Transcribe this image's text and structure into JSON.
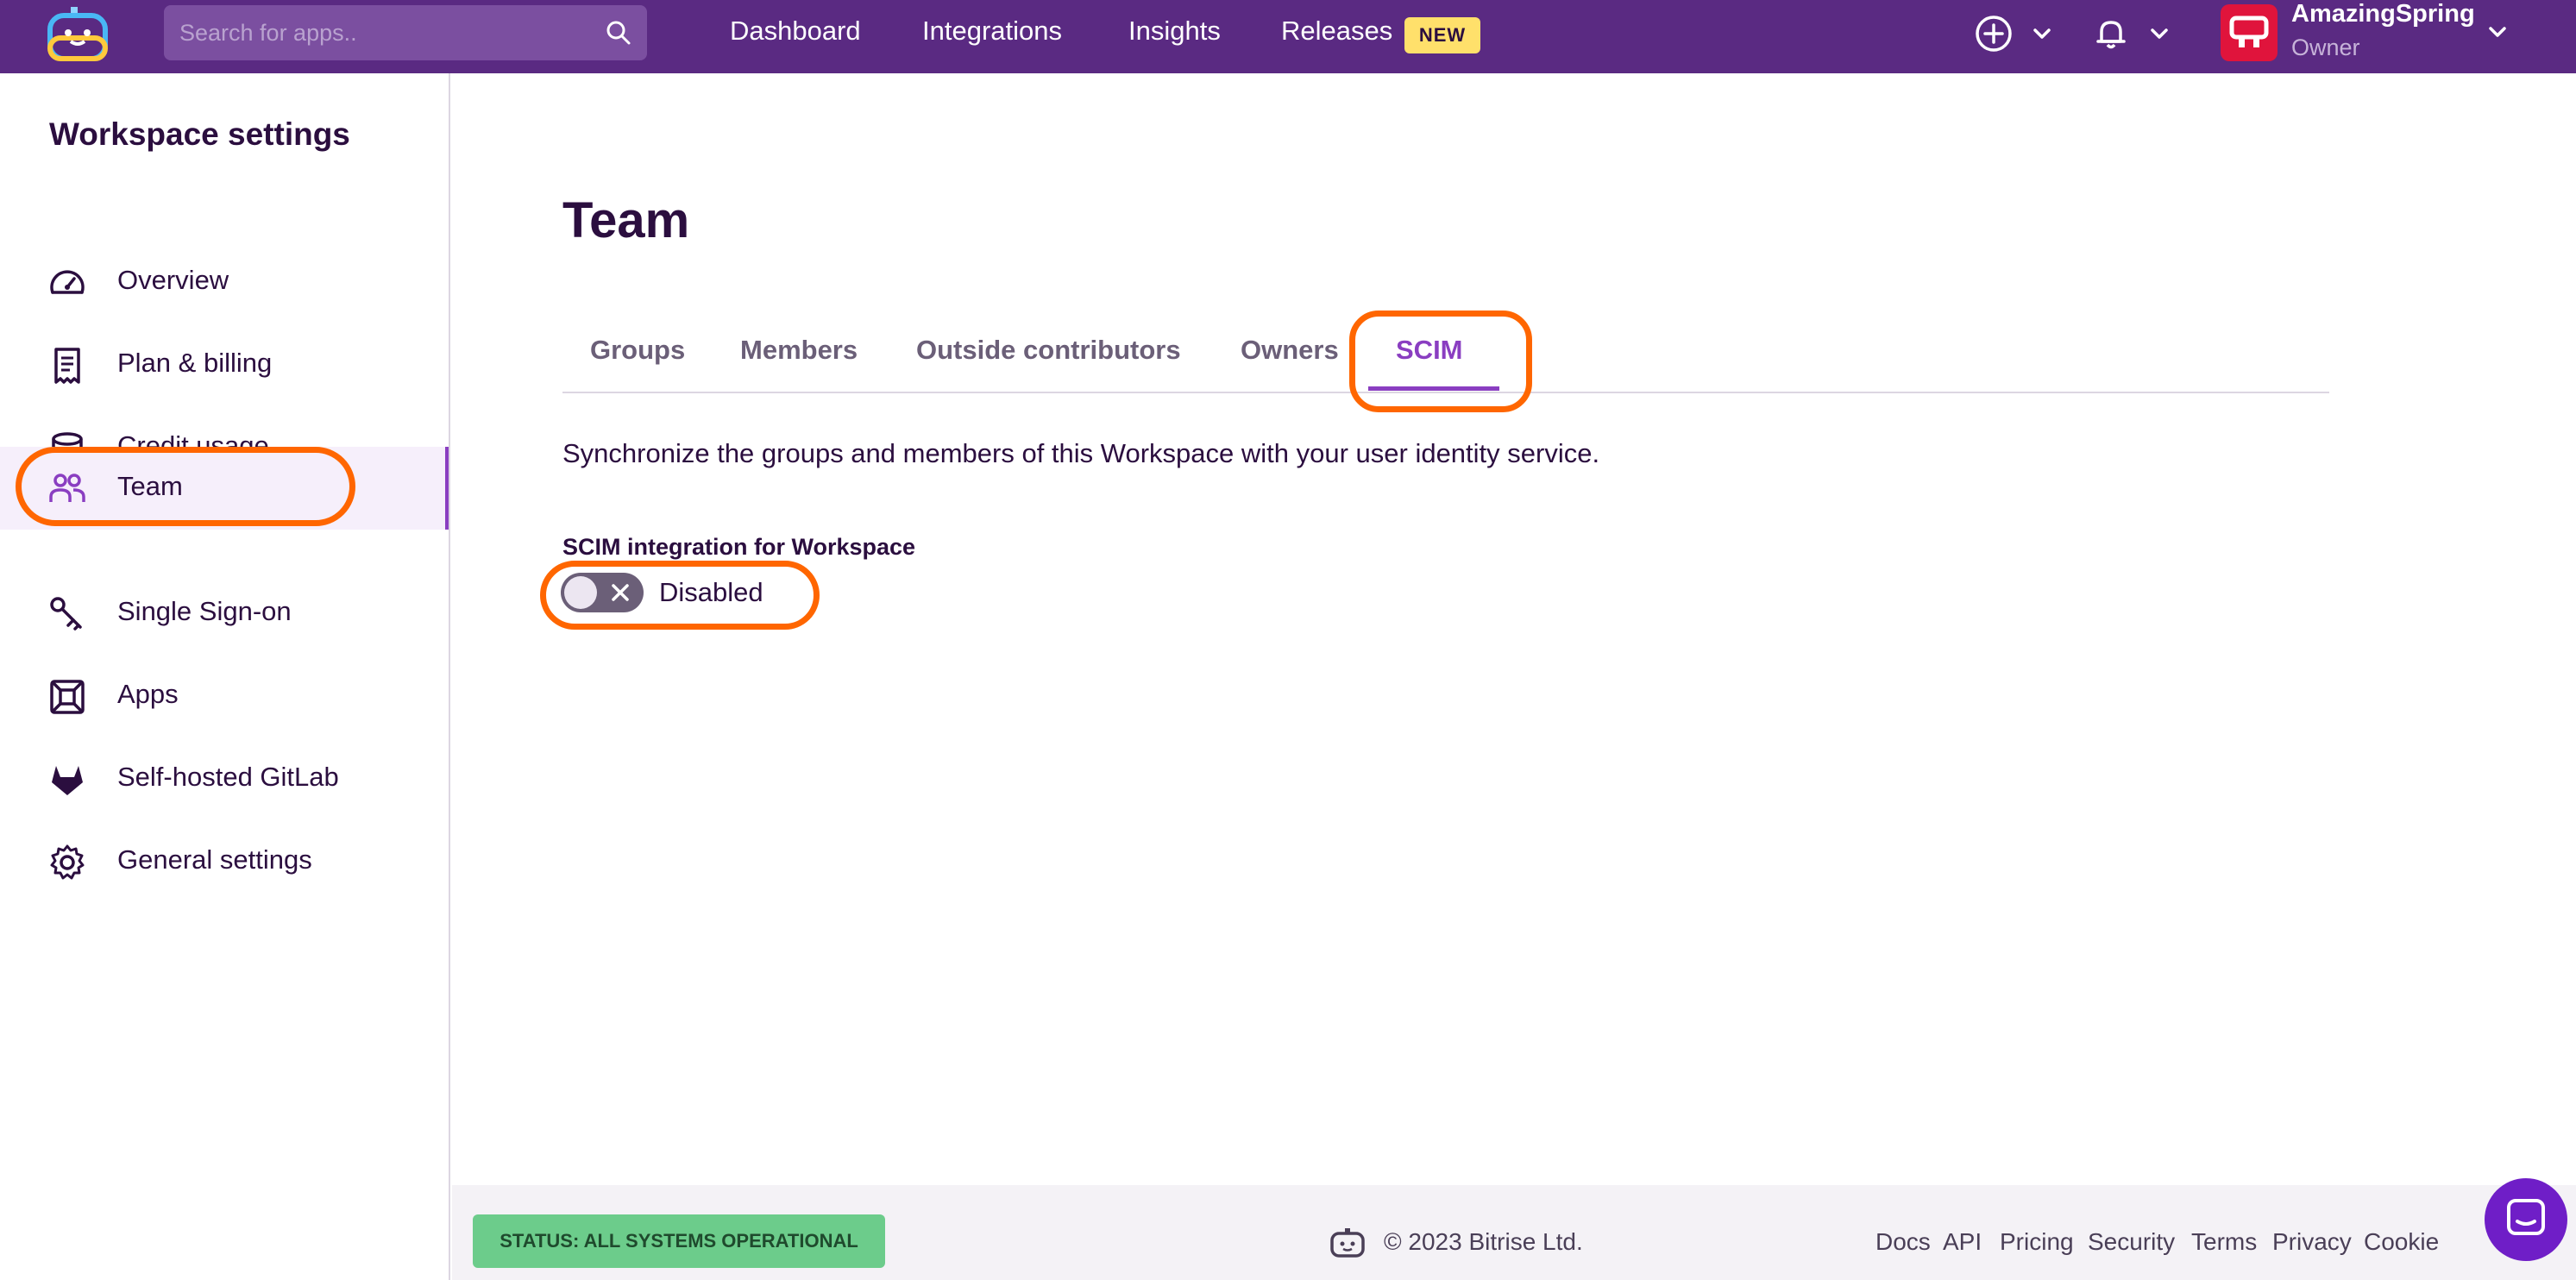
{
  "topbar": {
    "search_placeholder": "Search for apps..",
    "nav": [
      "Dashboard",
      "Integrations",
      "Insights",
      "Releases"
    ],
    "releases_badge": "NEW",
    "workspace_name": "AmazingSpring",
    "workspace_role": "Owner"
  },
  "sidebar": {
    "title": "Workspace settings",
    "items": [
      {
        "label": "Overview",
        "icon": "gauge-icon"
      },
      {
        "label": "Plan & billing",
        "icon": "receipt-icon"
      },
      {
        "label": "Credit usage",
        "icon": "coins-stack-icon"
      },
      {
        "label": "Team",
        "icon": "people-icon",
        "active": true
      },
      {
        "label": "Single Sign-on",
        "icon": "key-icon"
      },
      {
        "label": "Apps",
        "icon": "app-box-icon"
      },
      {
        "label": "Self-hosted GitLab",
        "icon": "gitlab-icon"
      },
      {
        "label": "General settings",
        "icon": "gear-icon"
      }
    ]
  },
  "main": {
    "title": "Team",
    "tabs": [
      "Groups",
      "Members",
      "Outside contributors",
      "Owners",
      "SCIM"
    ],
    "active_tab": "SCIM",
    "description": "Synchronize the groups and members of this Workspace with your user identity service.",
    "scim_label": "SCIM integration for Workspace",
    "toggle_state": "Disabled"
  },
  "footer": {
    "status": "STATUS: ALL SYSTEMS OPERATIONAL",
    "copyright": "© 2023 Bitrise Ltd.",
    "links": [
      "Docs",
      "API",
      "Pricing",
      "Security",
      "Terms",
      "Privacy",
      "Cookie"
    ]
  },
  "colors": {
    "topbar": "#5a2a82",
    "accent": "#8a3ec1",
    "highlight_ring": "#ff6600",
    "status_green": "#6ccc8b",
    "chat_button": "#6f1ec7"
  }
}
